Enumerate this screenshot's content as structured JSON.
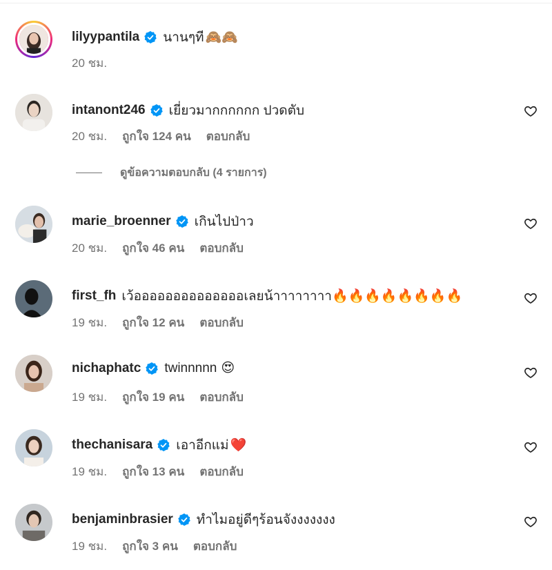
{
  "comments": [
    {
      "username": "lilyypantila",
      "text": "นานๆที",
      "emoji": "🙈🙈",
      "time": "20 ชม.",
      "likes": "",
      "reply": "",
      "avatar_color": "#c8a89a",
      "story_ring": true
    },
    {
      "username": "intanont246",
      "text": "เยี่ยวมากกกกกก ปวดตับ",
      "emoji": "",
      "time": "20 ชม.",
      "likes": "ถูกใจ 124 คน",
      "reply": "ตอบกลับ",
      "avatar_color": "#d9d4cf",
      "story_ring": false
    },
    {
      "username": "marie_broenner",
      "text": "เกินไปป่าว",
      "emoji": "",
      "time": "20 ชม.",
      "likes": "ถูกใจ 46 คน",
      "reply": "ตอบกลับ",
      "avatar_color": "#c9c2c0",
      "story_ring": false
    },
    {
      "username": "first_fh",
      "text": "เว้ออออออออออออออเลยน้าาาาาาาา",
      "emoji": "🔥🔥🔥🔥🔥🔥🔥🔥",
      "time": "19 ชม.",
      "likes": "ถูกใจ 12 คน",
      "reply": "ตอบกลับ",
      "avatar_color": "#2f3a44",
      "story_ring": false
    },
    {
      "username": "nichaphatc",
      "text": "twinnnnn",
      "emoji": "😍",
      "time": "19 ชม.",
      "likes": "ถูกใจ 19 คน",
      "reply": "ตอบกลับ",
      "avatar_color": "#8a6d5c",
      "story_ring": false
    },
    {
      "username": "thechanisara",
      "text": "เอาอีกแม่",
      "emoji": "❤️",
      "time": "19 ชม.",
      "likes": "ถูกใจ 13 คน",
      "reply": "ตอบกลับ",
      "avatar_color": "#b7a79b",
      "story_ring": false
    },
    {
      "username": "benjaminbrasier",
      "text": "ทำไมอยู่ดีๆร้อนจังงงงงงง",
      "emoji": "",
      "time": "19 ชม.",
      "likes": "ถูกใจ 3 คน",
      "reply": "ตอบกลับ",
      "avatar_color": "#9a8f86",
      "story_ring": false
    }
  ],
  "view_replies": "ดูข้อความตอบกลับ (4 รายการ)",
  "colors": {
    "verified": "#0095f6",
    "meta_text": "#737373",
    "primary_text": "#262626"
  }
}
